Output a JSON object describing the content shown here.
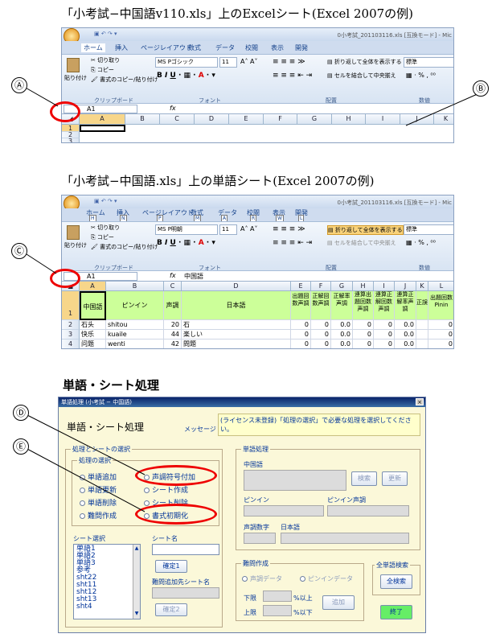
{
  "caption1": "「小考試−中国語v110.xls」上のExcelシート(Excel 2007の例)",
  "caption2": "「小考試−中国語.xls」上の単語シート(Excel 2007の例)",
  "caption3": "単語・シート処理",
  "labels": {
    "a": "Ⓐ",
    "b": "Ⓑ",
    "c": "Ⓒ",
    "d": "Ⓓ",
    "e": "Ⓔ"
  },
  "excel1": {
    "title": "0小考試_201103116.xls [互換モード] - Mic",
    "tabs": [
      "ホーム",
      "挿入",
      "ページレイアウト",
      "数式",
      "データ",
      "校閲",
      "表示",
      "開発"
    ],
    "clip": {
      "paste": "貼り付け",
      "cut": "切り取り",
      "copy": "コピー",
      "fmt": "書式のコピー/貼り付け",
      "group": "クリップボード"
    },
    "font": {
      "name": "MS Pゴシック",
      "size": "11",
      "group": "フォント"
    },
    "align": {
      "wrap": "折り返して全体を表示する",
      "merge": "セルを結合して中央揃え",
      "group": "配置"
    },
    "number": {
      "fmt": "標準",
      "group": "数値"
    },
    "namebox": "A1",
    "fx": "fx",
    "columns": [
      "A",
      "B",
      "C",
      "D",
      "E",
      "F",
      "G",
      "H",
      "I",
      "J",
      "K"
    ],
    "rows": [
      "1",
      "2",
      "3"
    ]
  },
  "excel2": {
    "title": "0小考試_201103116.xls [互換モード] - Mic",
    "tabs": [
      "ホーム",
      "挿入",
      "ページレイアウト",
      "数式",
      "データ",
      "校閲",
      "表示",
      "開発"
    ],
    "keys": [
      "H",
      "N",
      "P",
      "M",
      "A",
      "R",
      "W",
      "L"
    ],
    "clip": {
      "paste": "貼り付け",
      "cut": "切り取り",
      "copy": "コピー",
      "fmt": "書式のコピー/貼り付け",
      "group": "クリップボード"
    },
    "font": {
      "name": "MS P明朝",
      "size": "11",
      "group": "フォント"
    },
    "align": {
      "wrap": "折り返して全体を表示する",
      "merge": "セルを結合して中央揃え",
      "group": "配置"
    },
    "number": {
      "fmt": "標準",
      "group": "数値"
    },
    "namebox": "A1",
    "fx": "fx",
    "formula": "中国語",
    "columns": [
      "A",
      "B",
      "C",
      "D",
      "E",
      "F",
      "G",
      "H",
      "I",
      "J",
      "K",
      "L"
    ],
    "headers": [
      "中国語",
      "ピンイン",
      "声調",
      "日本語",
      "出題回数声調",
      "正解回数声調",
      "正解率声調",
      "連算出題回数声調",
      "連算正解回数声調",
      "連算正解率声調",
      "正誤",
      "出題回数Pinin"
    ],
    "rows": [
      {
        "n": "2",
        "a": "石头",
        "b": "shitou",
        "c": "20",
        "d": "石",
        "e": "0",
        "f": "0",
        "g": "0.0",
        "h": "0",
        "i": "0",
        "j": "0.0",
        "l": "0"
      },
      {
        "n": "3",
        "a": "快乐",
        "b": "kuaile",
        "c": "44",
        "d": "楽しい",
        "e": "0",
        "f": "0",
        "g": "0.0",
        "h": "0",
        "i": "0",
        "j": "0.0",
        "l": "0"
      },
      {
        "n": "4",
        "a": "问题",
        "b": "wenti",
        "c": "42",
        "d": "問題",
        "e": "0",
        "f": "0",
        "g": "0.0",
        "h": "0",
        "i": "0",
        "j": "0.0",
        "l": "0"
      }
    ],
    "row1": "1"
  },
  "dialog": {
    "title": "単語処理 (小考試 − 中国語)",
    "close": "×",
    "heading": "単語・シート処理",
    "msg_label": "メッセージ",
    "msg": "(ライセンス未登録)「処理の選択」で必要な処理を選択してください。",
    "sel_group": "処理とシートの選択",
    "proc_group": "処理の選択",
    "radios": [
      "単語追加",
      "単語更新",
      "単語削除",
      "難問作成",
      "声調符号付加",
      "シート作成",
      "シート削除",
      "書式初期化"
    ],
    "sheet_sel": "シート選択",
    "sheets": [
      "単語1",
      "単語2",
      "単語3",
      "参考",
      "sht22",
      "sht11",
      "sht12",
      "sht13",
      "sht4"
    ],
    "sheetname": "シート名",
    "confirm1": "確定1",
    "target": "難問追加先シート名",
    "confirm2": "確定2",
    "word_group": "単語処理",
    "chinese": "中国語",
    "search": "検索",
    "update": "更新",
    "pinyin": "ピンイン",
    "pinyin_tone": "ピンイン声調",
    "tone_num": "声調数字",
    "japanese": "日本語",
    "hard_group": "難問作成",
    "opt1": "声調データ",
    "opt2": "ピンインデータ",
    "lower": "下限",
    "upper": "上限",
    "above": "%以上",
    "below": "%以下",
    "add": "追加",
    "all_group": "全単語検索",
    "all_search": "全検索",
    "end": "終了"
  }
}
